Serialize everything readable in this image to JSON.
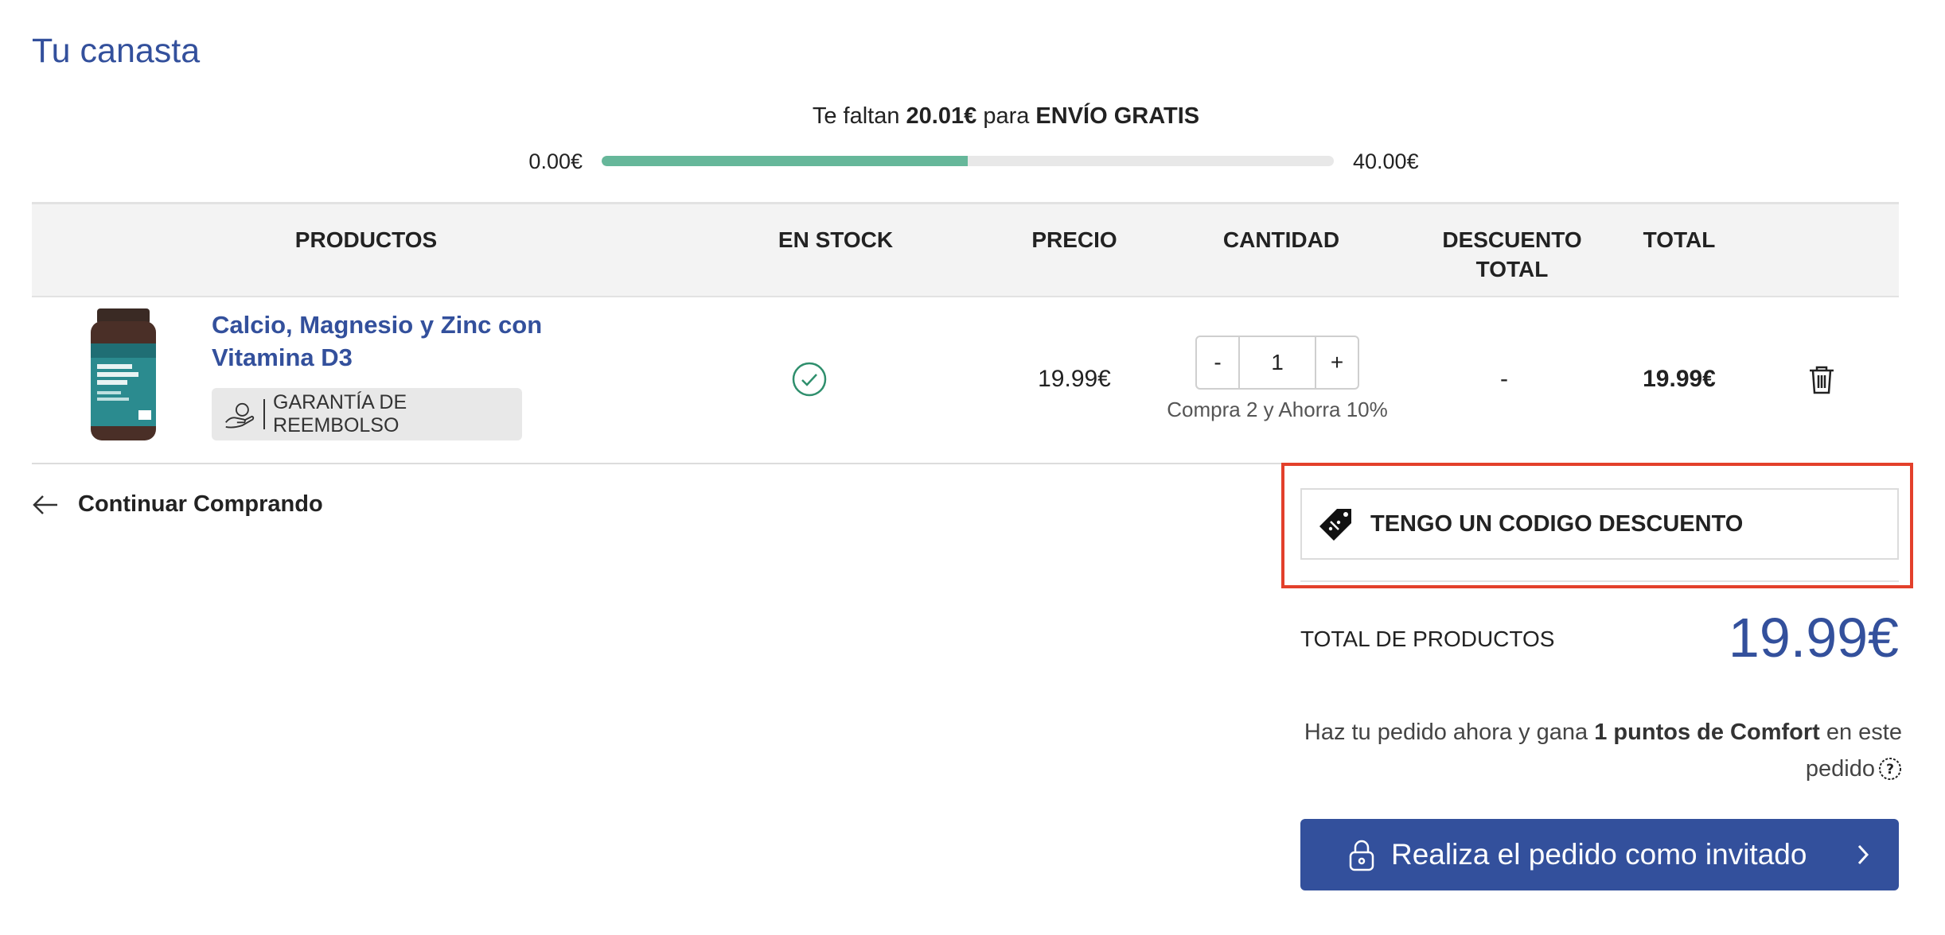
{
  "page": {
    "title": "Tu canasta"
  },
  "shipping": {
    "prefix": "Te faltan",
    "amount": "20.01€",
    "middle": "para",
    "target": "ENVÍO GRATIS",
    "min": "0.00€",
    "max": "40.00€",
    "progress_fraction": 0.4998,
    "color": "#66b79a"
  },
  "table": {
    "headers": {
      "products": "PRODUCTOS",
      "stock": "EN STOCK",
      "price": "PRECIO",
      "quantity": "CANTIDAD",
      "discount_line1": "DESCUENTO",
      "discount_line2": "TOTAL",
      "total": "TOTAL"
    },
    "rows": [
      {
        "name": "Calcio, Magnesio y Zinc con Vitamina D3",
        "badge": "GARANTÍA DE REEMBOLSO",
        "badge_icon": "hand-guarantee-icon",
        "stock_icon": "check-circle-icon",
        "price": "19.99€",
        "qty_minus": "-",
        "qty": "1",
        "qty_plus": "+",
        "qty_promo": "Compra 2 y Ahorra 10%",
        "discount": "-",
        "total": "19.99€",
        "remove_icon": "trash-icon"
      }
    ]
  },
  "continue_label": "Continuar Comprando",
  "coupon": {
    "label": "TENGO UN CODIGO DESCUENTO",
    "icon": "discount-tag-icon"
  },
  "summary": {
    "total_label": "TOTAL DE PRODUCTOS",
    "total_value": "19.99€",
    "points_prefix": "Haz tu pedido ahora y gana",
    "points_bold": "1 puntos de Comfort",
    "points_suffix": "en este pedido"
  },
  "checkout": {
    "label": "Realiza el pedido como invitado",
    "icon": "lock-icon"
  },
  "colors": {
    "brand": "#33509c",
    "highlight": "#e3402b"
  }
}
